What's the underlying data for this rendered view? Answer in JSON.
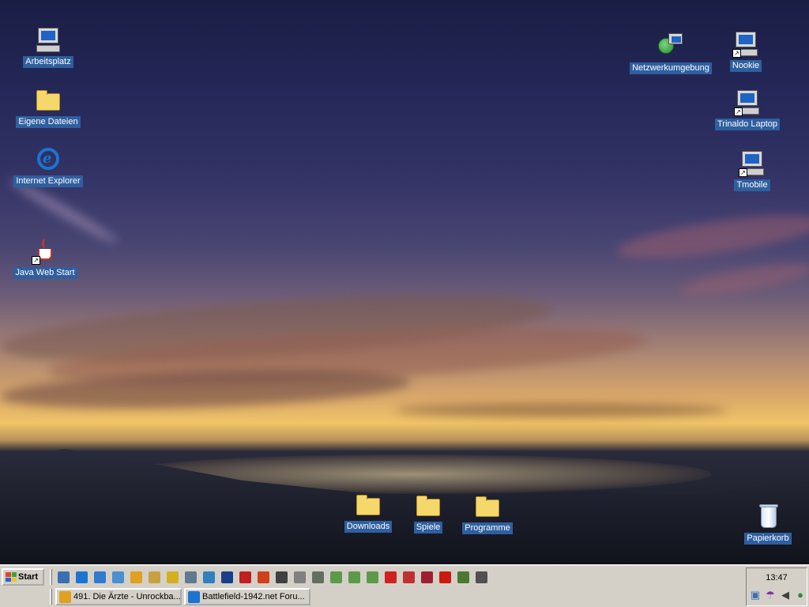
{
  "desktop": {
    "icons": {
      "arbeitsplatz": "Arbeitsplatz",
      "eigene_dateien": "Eigene Dateien",
      "internet_explorer": "Internet Explorer",
      "java_web_start": "Java Web Start",
      "netzwerkumgebung": "Netzwerkumgebung",
      "nookie": "Nookie",
      "trinaldo_laptop": "Trinaldo Laptop",
      "tmobile": "Tmobile",
      "downloads": "Downloads",
      "spiele": "Spiele",
      "programme": "Programme",
      "papierkorb": "Papierkorb"
    }
  },
  "taskbar": {
    "start_label": "Start",
    "quick_launch": [
      {
        "icon": "desktop-icon",
        "color": "#3a6fb0"
      },
      {
        "icon": "internet-explorer-icon",
        "color": "#1c74d2"
      },
      {
        "icon": "network-icon",
        "color": "#2e7bcf"
      },
      {
        "icon": "dialer-icon",
        "color": "#4a8fd0"
      },
      {
        "icon": "pencil-icon",
        "color": "#e0a020"
      },
      {
        "icon": "archive-icon",
        "color": "#c8a040"
      },
      {
        "icon": "key-icon",
        "color": "#d4b020"
      },
      {
        "icon": "monitor-icon",
        "color": "#607890"
      },
      {
        "icon": "ftp-icon",
        "color": "#3080c0"
      },
      {
        "icon": "flag-icon",
        "color": "#1a3f8a"
      },
      {
        "icon": "mail-8-icon",
        "color": "#c02020"
      },
      {
        "icon": "media-player-icon",
        "color": "#d0401a"
      },
      {
        "icon": "headphones-icon",
        "color": "#404040"
      },
      {
        "icon": "gear-icon",
        "color": "#808080"
      },
      {
        "icon": "game-icon",
        "color": "#607060"
      },
      {
        "icon": "cash-icon",
        "color": "#5c9a4a"
      },
      {
        "icon": "cash-icon",
        "color": "#5c9a4a"
      },
      {
        "icon": "cash-icon",
        "color": "#5c9a4a"
      },
      {
        "icon": "acrobat-icon",
        "color": "#d02020"
      },
      {
        "icon": "plane-icon",
        "color": "#c03030"
      },
      {
        "icon": "emblem-icon",
        "color": "#9a2030"
      },
      {
        "icon": "hammer-sickle-icon",
        "color": "#cc1a10"
      },
      {
        "icon": "alien-icon",
        "color": "#4a7a30"
      },
      {
        "icon": "safe-icon",
        "color": "#505050"
      }
    ],
    "tasks": [
      {
        "label": "491. Die Ärzte - Unrockba...",
        "icon": "winamp-icon",
        "color": "#e0a020"
      },
      {
        "label": "Battlefield-1942.net Foru...",
        "icon": "internet-explorer-icon",
        "color": "#1c74d2"
      }
    ],
    "tray": {
      "time": "13:47",
      "icons": [
        "network-icon",
        "umbrella-icon",
        "speaker-icon",
        "messenger-icon"
      ]
    }
  }
}
